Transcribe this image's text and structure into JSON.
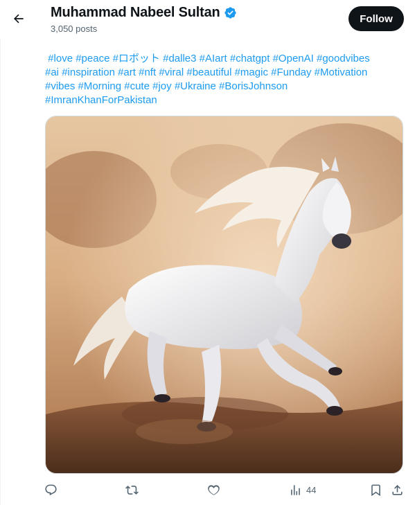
{
  "header": {
    "profile_name": "Muhammad Nabeel Sultan",
    "post_count": "3,050 posts",
    "follow_label": "Follow"
  },
  "post": {
    "hashtags_lines": [
      [
        "#love",
        "#peace",
        "#ロボット",
        "#dalle3",
        "#AIart",
        "#chatgpt",
        "#OpenAI",
        "#goodvibes"
      ],
      [
        "#ai",
        "#inspiration",
        "#art",
        "#nft",
        "#viral",
        "#beautiful",
        "#magic",
        "#Funday",
        "#Motivation"
      ],
      [
        "#vibes",
        "#Morning",
        "#cute",
        "#joy",
        "#Ukraine",
        "#BorisJohnson"
      ],
      [
        "#ImranKhanForPakistan"
      ]
    ]
  },
  "actions": {
    "views_count": "44"
  },
  "icons": {
    "back": "arrow-left-icon",
    "verified": "verified-badge-icon",
    "reply": "reply-icon",
    "repost": "repost-icon",
    "like": "heart-icon",
    "views": "views-chart-icon",
    "bookmark": "bookmark-icon",
    "share": "share-icon"
  },
  "colors": {
    "accent": "#1d9bf0",
    "text": "#0f1419",
    "muted": "#536471",
    "follow_bg": "#0f1419"
  }
}
